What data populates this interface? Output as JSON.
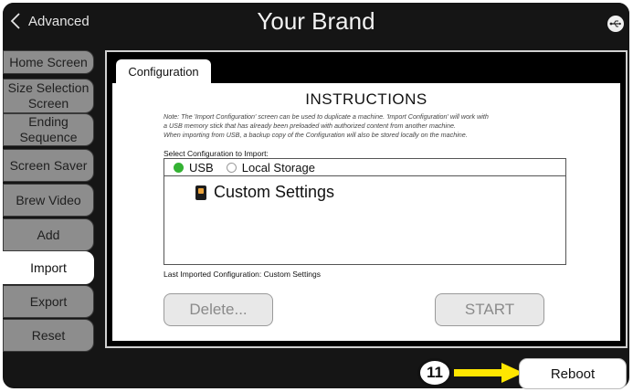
{
  "topbar": {
    "back_label": "Advanced",
    "brand": "Your Brand",
    "usb_icon": "usb-icon"
  },
  "sidebar": {
    "items": [
      {
        "label": "Home Screen"
      },
      {
        "label": "Size Selection Screen"
      },
      {
        "label": "Ending Sequence"
      },
      {
        "label": "Screen Saver"
      },
      {
        "label": "Brew Video"
      },
      {
        "label": "Add"
      },
      {
        "label": "Import"
      },
      {
        "label": "Export"
      },
      {
        "label": "Reset"
      }
    ],
    "active": "Import"
  },
  "panel": {
    "tab": "Configuration",
    "title": "INSTRUCTIONS",
    "note_lines": [
      "Note: The 'Import Configuration' screen can be used to duplicate a machine. 'Import Configuration' will work with",
      "a USB memory stick that has already been preloaded with authorized content from another machine.",
      "When importing from USB, a backup copy of the Configuration will also be stored locally on the machine."
    ],
    "select_label": "Select Configuration to Import:",
    "sources": {
      "usb": "USB",
      "local": "Local Storage",
      "selected": "USB"
    },
    "items": [
      "Custom Settings"
    ],
    "last_imported": "Last Imported Configuration: Custom Settings",
    "delete_label": "Delete...",
    "start_label": "START"
  },
  "footer": {
    "callout_number": "11",
    "reboot_label": "Reboot"
  },
  "colors": {
    "accent_green": "#34b233",
    "arrow_yellow": "#ffe600",
    "frame": "#151515"
  }
}
